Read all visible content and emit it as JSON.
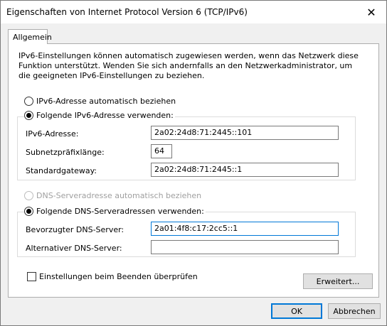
{
  "window": {
    "title": "Eigenschaften von Internet Protocol Version 6 (TCP/IPv6)",
    "close_glyph": "✕"
  },
  "tabs": {
    "general": "Allgemein"
  },
  "description": "IPv6-Einstellungen können automatisch zugewiesen werden, wenn das Netzwerk diese Funktion unterstützt. Wenden Sie sich andernfalls an den Netzwerkadministrator, um die geeigneten IPv6-Einstellungen zu beziehen.",
  "ip": {
    "auto_label": "IPv6-Adresse automatisch beziehen",
    "manual_label": "Folgende IPv6-Adresse verwenden:",
    "address_label": "IPv6-Adresse:",
    "address_value": "2a02:24d8:71:2445::101",
    "prefix_label": "Subnetzpräfixlänge:",
    "prefix_value": "64",
    "gateway_label": "Standardgateway:",
    "gateway_value": "2a02:24d8:71:2445::1"
  },
  "dns": {
    "auto_label": "DNS-Serveradresse automatisch beziehen",
    "manual_label": "Folgende DNS-Serveradressen verwenden:",
    "preferred_label": "Bevorzugter DNS-Server:",
    "preferred_value": "2a01:4f8:c17:2cc5::1",
    "alternate_label": "Alternativer DNS-Server:",
    "alternate_value": ""
  },
  "validate_label": "Einstellungen beim Beenden überprüfen",
  "buttons": {
    "advanced": "Erweitert...",
    "ok": "OK",
    "cancel": "Abbrechen"
  }
}
